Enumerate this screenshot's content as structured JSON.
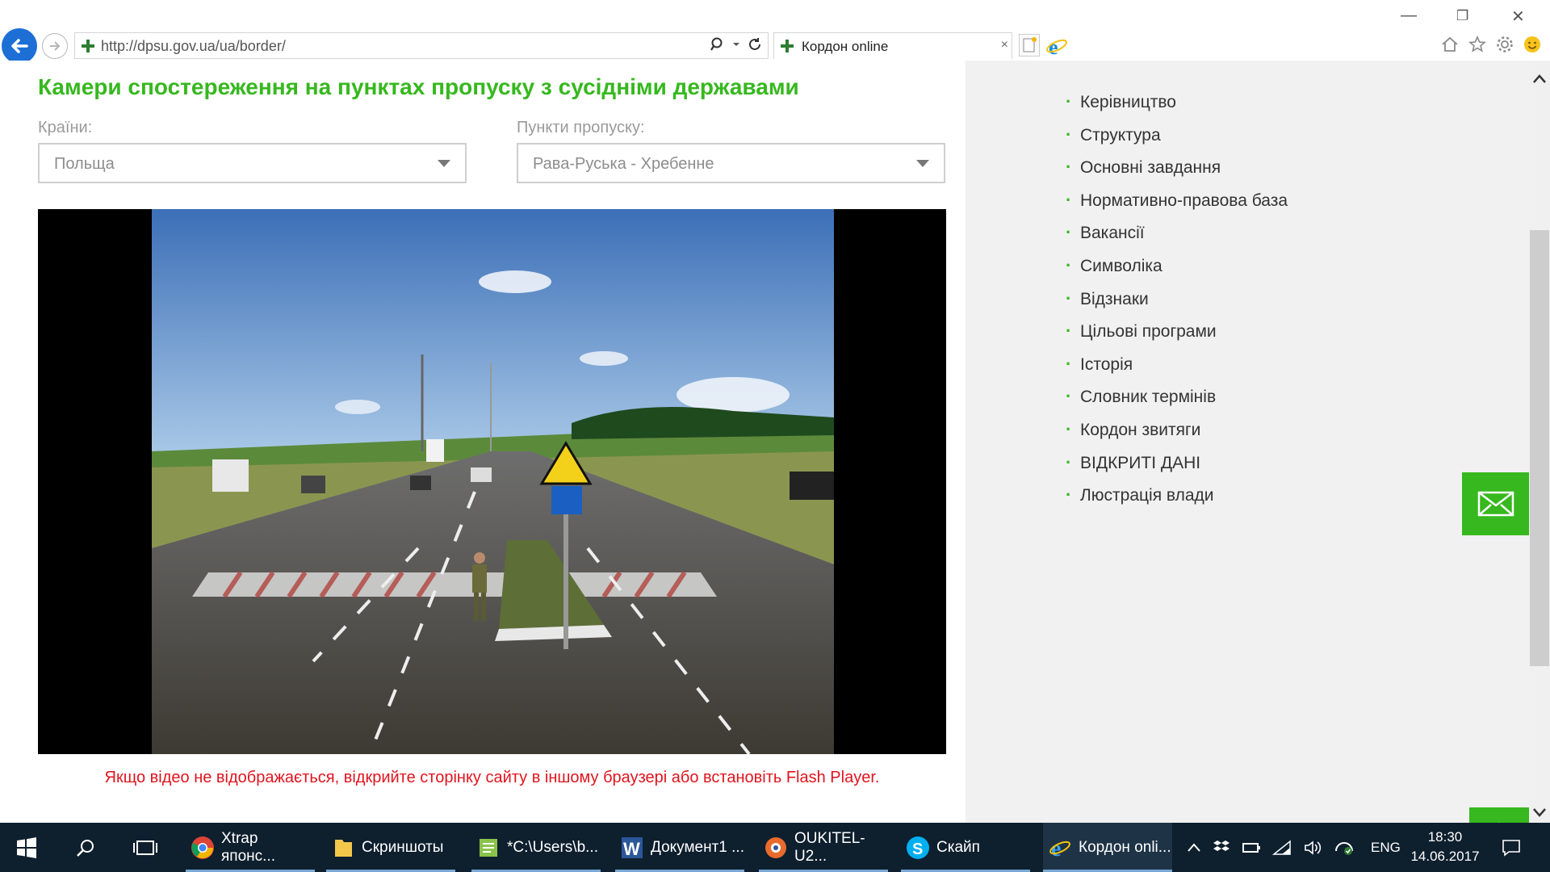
{
  "browser": {
    "url": "http://dpsu.gov.ua/ua/border/",
    "tab_title": "Кордон online",
    "tab_close": "×"
  },
  "page": {
    "title": "Камери спостереження на пунктах пропуску з сусідніми державами",
    "countries_label": "Країни:",
    "countries_value": "Польща",
    "checkpoints_label": "Пункти пропуску:",
    "checkpoints_value": "Рава-Руська - Хребенне",
    "video_warning": "Якщо відео не відображається, відкрийте сторінку сайту в іншому браузері або встановіть Flash Player."
  },
  "sidebar": {
    "items": [
      {
        "label": "Керівництво"
      },
      {
        "label": "Структура"
      },
      {
        "label": "Основні завдання"
      },
      {
        "label": "Нормативно-правова база"
      },
      {
        "label": "Вакансії"
      },
      {
        "label": "Символіка"
      },
      {
        "label": "Відзнаки"
      },
      {
        "label": "Цільові програми"
      },
      {
        "label": "Історія"
      },
      {
        "label": "Словник термінів"
      },
      {
        "label": "Кордон звитяги"
      },
      {
        "label": "ВІДКРИТІ ДАНІ"
      },
      {
        "label": "Люстрація влади"
      }
    ]
  },
  "taskbar": {
    "items": [
      {
        "label": "Xtrap японс...",
        "icon": "chrome-icon"
      },
      {
        "label": "Скриншоты",
        "icon": "folder-icon"
      },
      {
        "label": "*C:\\Users\\b...",
        "icon": "notepad-icon"
      },
      {
        "label": "Документ1 ...",
        "icon": "word-icon"
      },
      {
        "label": "OUKITEL-U2...",
        "icon": "app-icon"
      },
      {
        "label": "Скайп",
        "icon": "skype-icon"
      },
      {
        "label": "Кордон onli...",
        "icon": "ie-icon"
      }
    ],
    "lang": "ENG",
    "time": "18:30",
    "date": "14.06.2017"
  },
  "colors": {
    "brand_green": "#36b81e",
    "warning_red": "#e0141e",
    "taskbar": "#0e1f2e"
  }
}
